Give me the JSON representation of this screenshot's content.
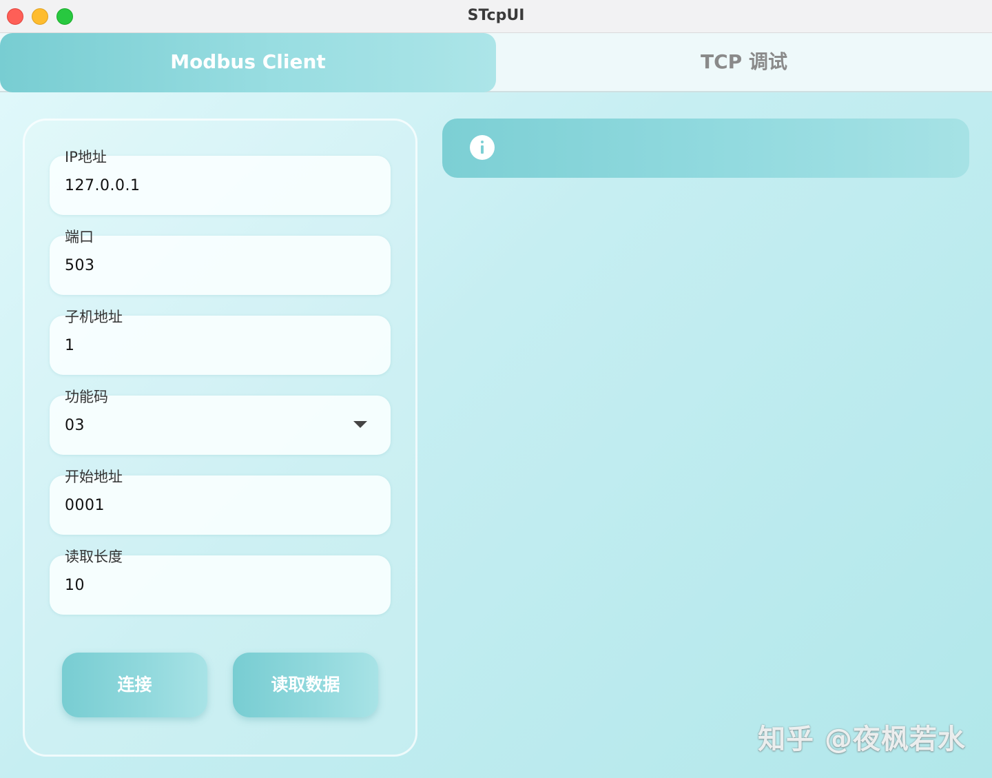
{
  "window": {
    "title": "STcpUI"
  },
  "tabs": [
    {
      "label": "Modbus Client",
      "active": true
    },
    {
      "label": "TCP 调试",
      "active": false
    }
  ],
  "form": {
    "fields": [
      {
        "label": "IP地址",
        "value": "127.0.0.1"
      },
      {
        "label": "端口",
        "value": "503"
      },
      {
        "label": "子机地址",
        "value": "1"
      },
      {
        "label": "功能码",
        "value": "03"
      },
      {
        "label": "开始地址",
        "value": "0001"
      },
      {
        "label": "读取长度",
        "value": "10"
      }
    ],
    "buttons": {
      "connect": "连接",
      "read_data": "读取数据"
    }
  },
  "info_banner": {
    "icon": "info-icon",
    "text": ""
  },
  "watermark": "知乎 @夜枫若水",
  "colors": {
    "accent": "#7ccfd4",
    "accent_light": "#a6e2e5",
    "tab_inactive_text": "#8a8a8a"
  }
}
